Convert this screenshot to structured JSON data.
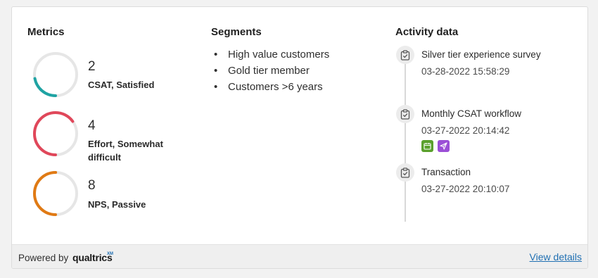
{
  "metrics": {
    "title": "Metrics",
    "items": [
      {
        "value": "2",
        "label": "CSAT, Satisfied",
        "color": "#1fa3a3",
        "fraction": 0.22
      },
      {
        "value": "4",
        "label": "Effort, Somewhat difficult",
        "color": "#e0475a",
        "fraction": 0.65
      },
      {
        "value": "8",
        "label": "NPS, Passive",
        "color": "#e07a14",
        "fraction": 0.5
      }
    ],
    "track_color": "#e6e6e6"
  },
  "segments": {
    "title": "Segments",
    "items": [
      "High value customers",
      "Gold tier member",
      "Customers >6 years"
    ]
  },
  "activity": {
    "title": "Activity data",
    "items": [
      {
        "title": "Silver tier experience survey",
        "time": "03-28-2022 15:58:29",
        "icon": "clipboard-check-icon"
      },
      {
        "title": "Monthly CSAT workflow",
        "time": "03-27-2022 20:14:42",
        "icon": "clipboard-check-icon",
        "badges": [
          {
            "icon": "calendar-icon",
            "color": "#5aa02c"
          },
          {
            "icon": "send-icon",
            "color": "#9b4fd6"
          }
        ]
      },
      {
        "title": "Transaction",
        "time": "03-27-2022 20:10:07",
        "icon": "clipboard-check-icon"
      }
    ]
  },
  "footer": {
    "powered_by": "Powered by",
    "brand": "qualtrics",
    "brand_sup": "XM",
    "link": "View details"
  }
}
